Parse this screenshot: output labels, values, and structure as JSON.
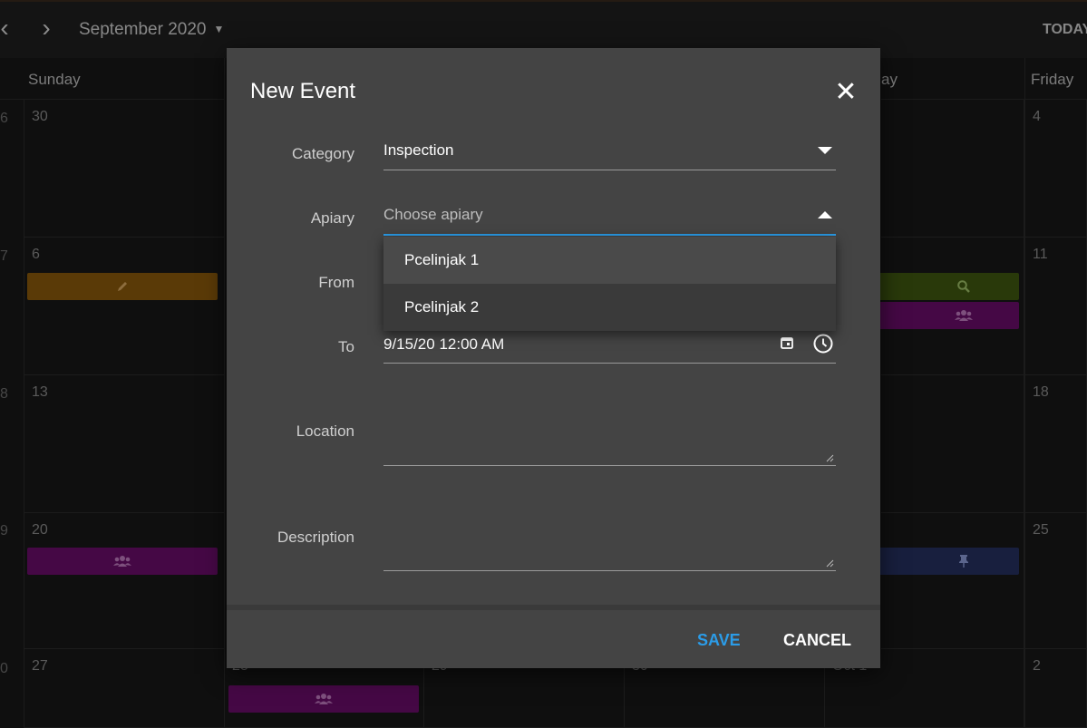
{
  "toolbar": {
    "prev_glyph": "‹",
    "next_glyph": "›",
    "month_label": "September 2020",
    "today_label": "TODAY"
  },
  "calendar": {
    "day_headers": [
      "Sunday",
      "Friday",
      "ay"
    ],
    "week_numbers": [
      "6",
      "7",
      "8",
      "9",
      "0"
    ],
    "sunday_dates": [
      "30",
      "6",
      "13",
      "20",
      "27"
    ],
    "friday_dates": [
      "4",
      "11",
      "18",
      "25",
      "2"
    ],
    "partial_dates": [
      "28",
      "29",
      "30",
      "Oct 1"
    ],
    "events": [
      {
        "icon": "pencil-icon",
        "color": "#8a5a0c"
      },
      {
        "icon": "search-icon",
        "color": "#3f5810"
      },
      {
        "icon": "users-icon",
        "color": "#6b0d6b"
      },
      {
        "icon": "users-icon",
        "color": "#6b0d6b"
      },
      {
        "icon": "pin-icon",
        "color": "#253060"
      },
      {
        "icon": "users-icon",
        "color": "#6b0d6b"
      }
    ]
  },
  "dialog": {
    "title": "New Event",
    "close_glyph": "✕",
    "fields": {
      "category": {
        "label": "Category",
        "value": "Inspection"
      },
      "apiary": {
        "label": "Apiary",
        "placeholder": "Choose apiary",
        "accent": "#2b9ce8"
      },
      "from": {
        "label": "From"
      },
      "to": {
        "label": "To",
        "value": "9/15/20 12:00 AM"
      },
      "location": {
        "label": "Location",
        "value": ""
      },
      "description": {
        "label": "Description",
        "value": ""
      }
    },
    "apiary_options": [
      "Pcelinjak 1",
      "Pcelinjak 2"
    ],
    "save_label": "SAVE",
    "cancel_label": "CANCEL"
  }
}
